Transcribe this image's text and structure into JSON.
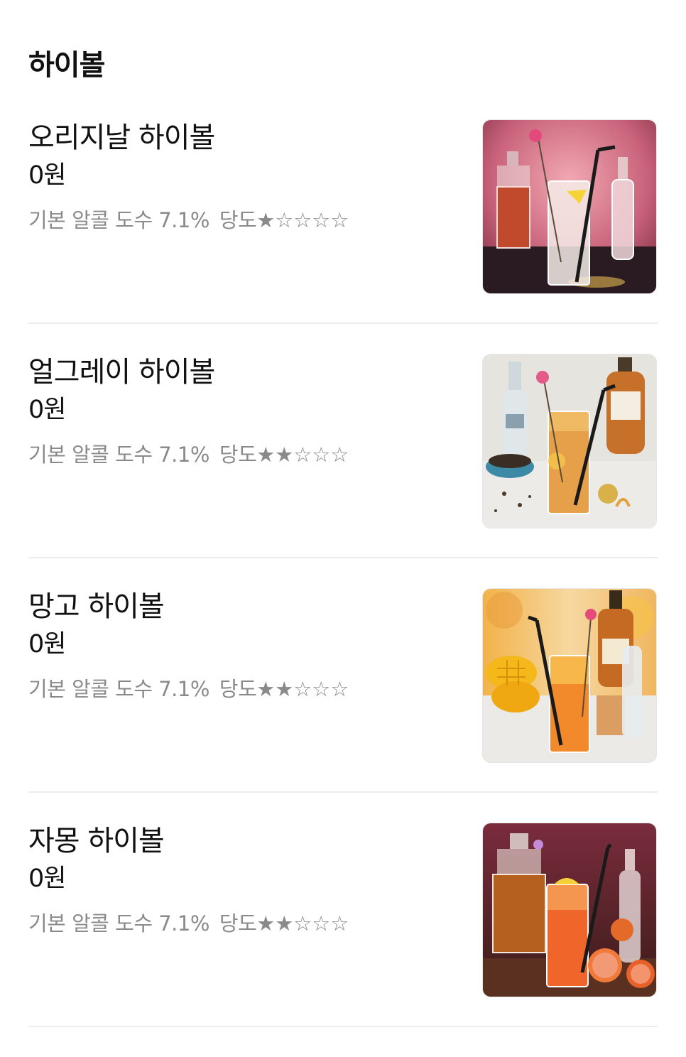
{
  "section": {
    "title": "하이볼"
  },
  "items": [
    {
      "name": "오리지날 하이볼",
      "price": "0원",
      "abv_text": "기본 알콜 도수 7.1%",
      "sweet_label": "당도",
      "stars": "★☆☆☆☆",
      "sweetness": 1,
      "sweetness_max": 5,
      "image": "original-highball-photo"
    },
    {
      "name": "얼그레이 하이볼",
      "price": "0원",
      "abv_text": "기본 알콜 도수 7.1%",
      "sweet_label": "당도",
      "stars": "★★☆☆☆",
      "sweetness": 2,
      "sweetness_max": 5,
      "image": "earl-grey-highball-photo"
    },
    {
      "name": "망고 하이볼",
      "price": "0원",
      "abv_text": "기본 알콜 도수 7.1%",
      "sweet_label": "당도",
      "stars": "★★☆☆☆",
      "sweetness": 2,
      "sweetness_max": 5,
      "image": "mango-highball-photo"
    },
    {
      "name": "자몽 하이볼",
      "price": "0원",
      "abv_text": "기본 알콜 도수 7.1%",
      "sweet_label": "당도",
      "stars": "★★☆☆☆",
      "sweetness": 2,
      "sweetness_max": 5,
      "image": "grapefruit-highball-photo"
    }
  ],
  "colors": {
    "title": "#111111",
    "desc": "#8a8a8a",
    "divider": "#ececec",
    "original_bg": "#c05a6c",
    "earlgrey_bg": "#e4e2dd",
    "mango_bg": "#f0c070",
    "grapefruit_bg": "#5a2a2a"
  }
}
